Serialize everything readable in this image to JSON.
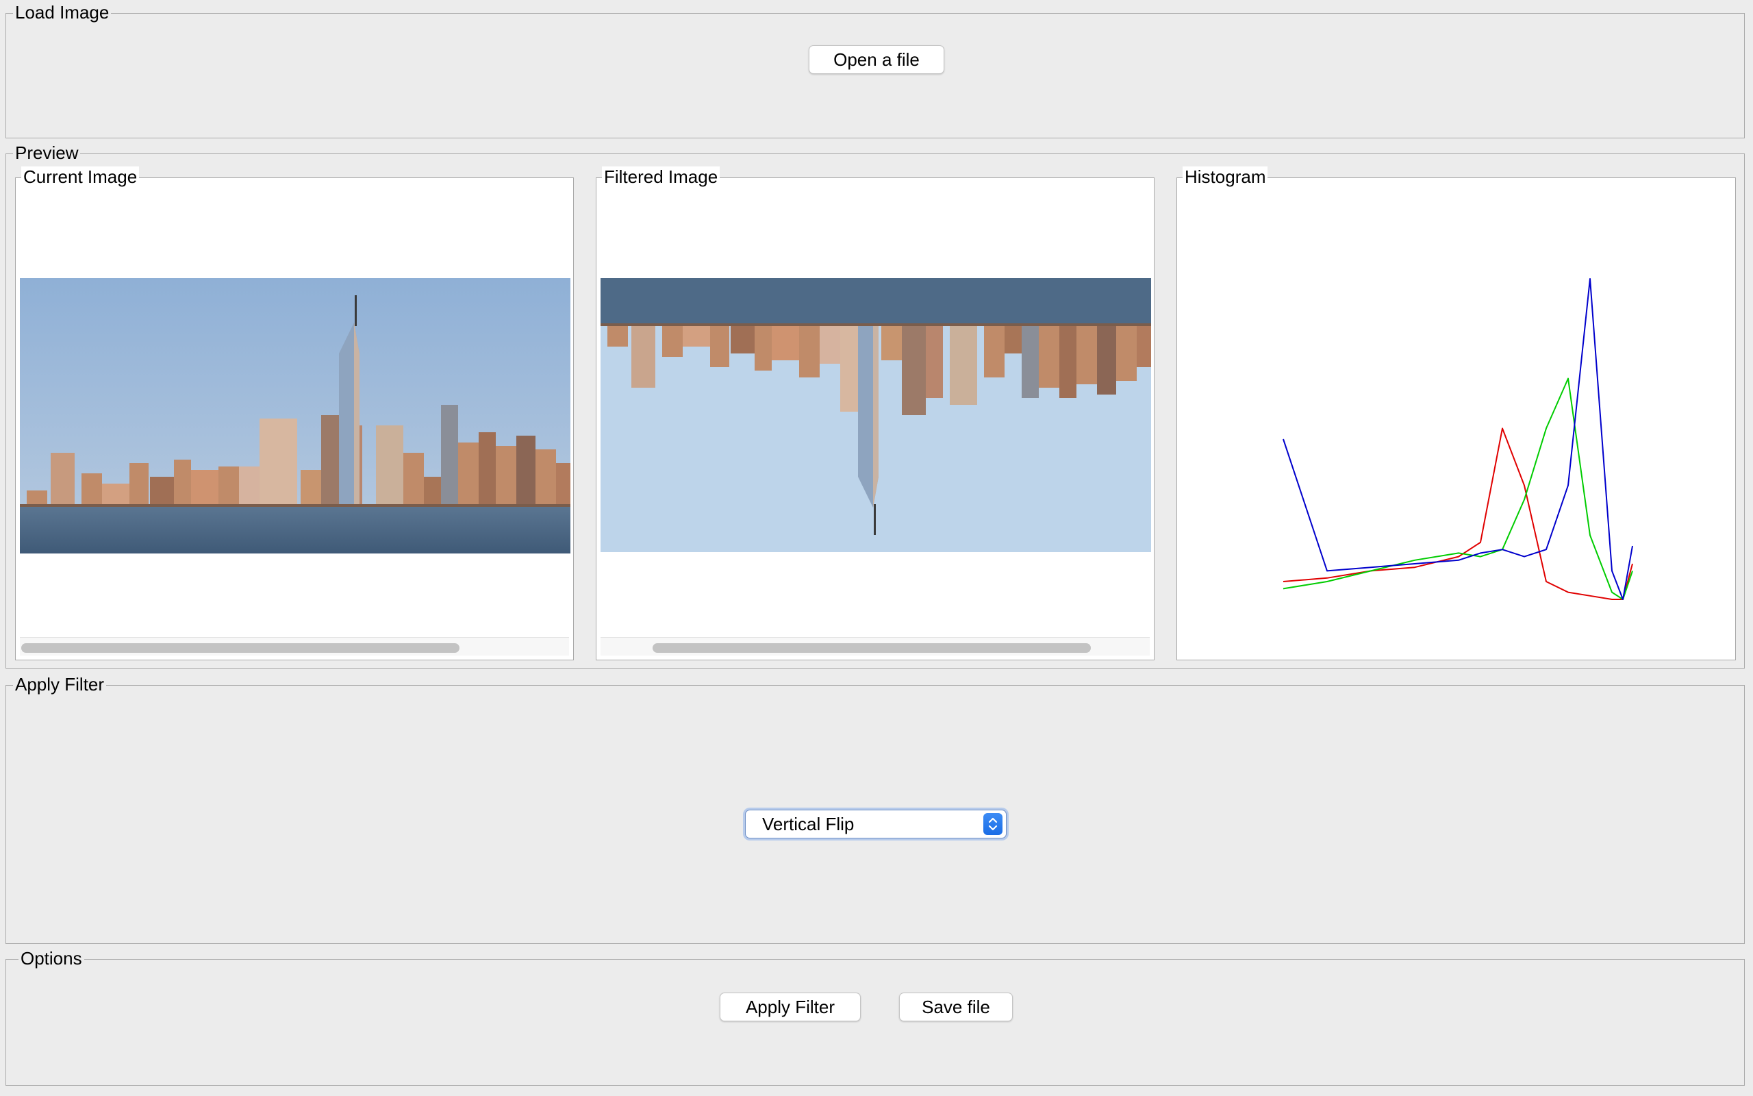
{
  "load_group": {
    "legend": "Load Image",
    "open_button": "Open a file"
  },
  "preview_group": {
    "legend": "Preview",
    "current": {
      "legend": "Current Image"
    },
    "filtered": {
      "legend": "Filtered Image"
    },
    "histogram": {
      "legend": "Histogram"
    }
  },
  "filter_group": {
    "legend": "Apply Filter",
    "select": {
      "selected": "Vertical Flip"
    }
  },
  "options_group": {
    "legend": "Options",
    "apply_button": "Apply Filter",
    "save_button": "Save file"
  },
  "colors": {
    "focus_accent": "#1a6de6"
  },
  "chart_data": {
    "type": "line",
    "x": [
      0,
      32,
      64,
      96,
      128,
      144,
      160,
      176,
      192,
      208,
      224,
      240,
      248,
      255
    ],
    "series": [
      {
        "name": "Red",
        "color": "#e00000",
        "values": [
          0.05,
          0.06,
          0.08,
          0.09,
          0.12,
          0.16,
          0.48,
          0.32,
          0.05,
          0.02,
          0.01,
          0.0,
          0.0,
          0.1
        ]
      },
      {
        "name": "Green",
        "color": "#00cc00",
        "values": [
          0.03,
          0.05,
          0.08,
          0.11,
          0.13,
          0.12,
          0.14,
          0.28,
          0.48,
          0.62,
          0.18,
          0.02,
          0.0,
          0.08
        ]
      },
      {
        "name": "Blue",
        "color": "#0000cc",
        "values": [
          0.45,
          0.08,
          0.09,
          0.1,
          0.11,
          0.13,
          0.14,
          0.12,
          0.14,
          0.32,
          0.9,
          0.08,
          0.0,
          0.15
        ]
      }
    ],
    "xlim": [
      0,
      255
    ],
    "ylim": [
      0,
      1
    ],
    "grid": false,
    "legend": "none"
  }
}
